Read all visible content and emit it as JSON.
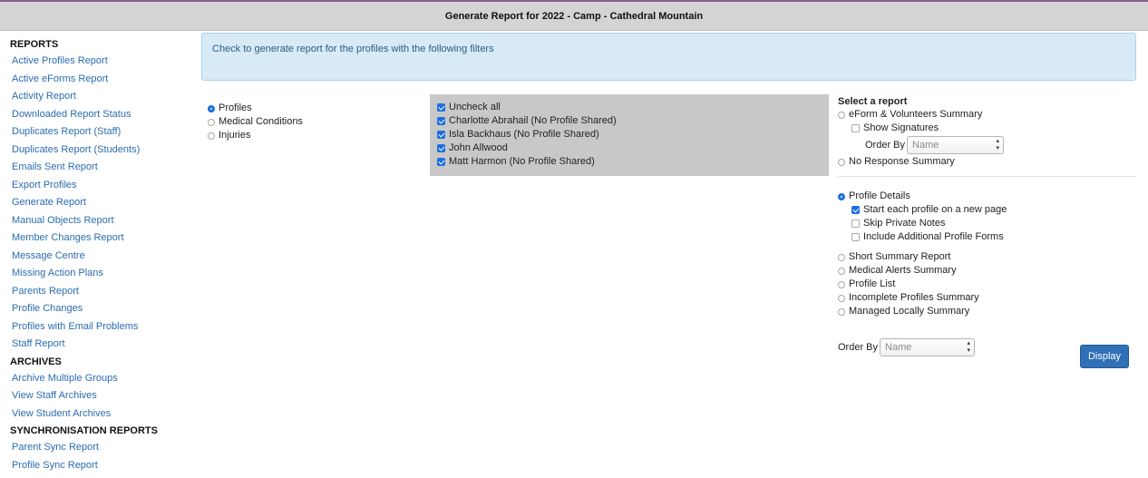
{
  "header": {
    "title": "Generate Report for 2022 - Camp - Cathedral Mountain"
  },
  "sidebar": {
    "sections": [
      {
        "heading": "REPORTS",
        "links": [
          "Active Profiles Report",
          "Active eForms Report",
          "Activity Report",
          "Downloaded Report Status",
          "Duplicates Report (Staff)",
          "Duplicates Report (Students)",
          "Emails Sent Report",
          "Export Profiles",
          "Generate Report",
          "Manual Objects Report",
          "Member Changes Report",
          "Message Centre",
          "Missing Action Plans",
          "Parents Report",
          "Profile Changes",
          "Profiles with Email Problems",
          "Staff Report"
        ]
      },
      {
        "heading": "ARCHIVES",
        "links": [
          "Archive Multiple Groups",
          "View Staff Archives",
          "View Student Archives"
        ]
      },
      {
        "heading": "SYNCHRONISATION REPORTS",
        "links": [
          "Parent Sync Report",
          "Profile Sync Report"
        ]
      }
    ]
  },
  "info": {
    "text": "Check to generate report for the profiles with the following filters"
  },
  "filters": [
    {
      "label": "Profiles",
      "selected": true
    },
    {
      "label": "Medical Conditions",
      "selected": false
    },
    {
      "label": "Injuries",
      "selected": false
    }
  ],
  "profiles": {
    "uncheck_label": "Uncheck all",
    "items": [
      {
        "label": "Charlotte Abrahail (No Profile Shared)",
        "checked": true
      },
      {
        "label": "Isla Backhaus (No Profile Shared)",
        "checked": true
      },
      {
        "label": "John Allwood",
        "checked": true
      },
      {
        "label": "Matt Harmon (No Profile Shared)",
        "checked": true
      }
    ]
  },
  "report": {
    "heading": "Select a report",
    "eform_label": "eForm & Volunteers Summary",
    "show_signatures": "Show Signatures",
    "order_by_label": "Order By",
    "order_by_value": "Name",
    "no_response": "No Response Summary",
    "profile_details": "Profile Details",
    "detail_options": [
      {
        "label": "Start each profile on a new page",
        "checked": true
      },
      {
        "label": "Skip Private Notes",
        "checked": false
      },
      {
        "label": "Include Additional Profile Forms",
        "checked": false
      }
    ],
    "other_reports": [
      "Short Summary Report",
      "Medical Alerts Summary",
      "Profile List",
      "Incomplete Profiles Summary",
      "Managed Locally Summary"
    ]
  },
  "bottom": {
    "order_by_label": "Order By",
    "order_by_value": "Name",
    "display_label": "Display"
  },
  "colors": {
    "link": "#2a6cb0",
    "accent": "#1d6fe0",
    "button": "#2f70b7",
    "info_bg": "#d7eaf5",
    "title_bar": "#d4d4d4"
  }
}
